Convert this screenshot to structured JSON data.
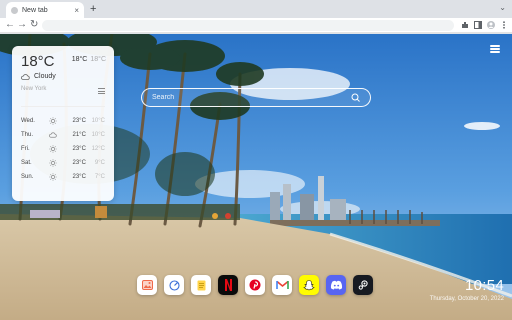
{
  "browser": {
    "tab_title": "New tab",
    "tab_close": "×",
    "new_tab": "+",
    "tab_menu": "⌄",
    "back": "←",
    "forward": "→",
    "reload": "↻"
  },
  "weather": {
    "temperature": "18°C",
    "high": "18°C",
    "low": "18°C",
    "condition": "Cloudy",
    "city": "New York",
    "forecast": [
      {
        "day": "Wed.",
        "icon": "sun-icon",
        "high": "23°C",
        "low": "10°C"
      },
      {
        "day": "Thu.",
        "icon": "cloud-icon",
        "high": "21°C",
        "low": "10°C"
      },
      {
        "day": "Fri.",
        "icon": "sun-icon",
        "high": "23°C",
        "low": "12°C"
      },
      {
        "day": "Sat.",
        "icon": "sun-icon",
        "high": "23°C",
        "low": "9°C"
      },
      {
        "day": "Sun.",
        "icon": "sun-icon",
        "high": "23°C",
        "low": "7°C"
      }
    ]
  },
  "search": {
    "placeholder": "Search"
  },
  "dock": {
    "apps": [
      {
        "name": "gallery-app-icon",
        "color": "#ffffff"
      },
      {
        "name": "compass-app-icon",
        "color": "#ffffff"
      },
      {
        "name": "notes-app-icon",
        "color": "#ffffff"
      },
      {
        "name": "netflix-app-icon",
        "color": "#0b0b0b"
      },
      {
        "name": "pinterest-app-icon",
        "color": "#ffffff"
      },
      {
        "name": "gmail-app-icon",
        "color": "#ffffff"
      },
      {
        "name": "snapchat-app-icon",
        "color": "#fffc00"
      },
      {
        "name": "discord-app-icon",
        "color": "#5865f2"
      },
      {
        "name": "steam-app-icon",
        "color": "#171a21"
      }
    ]
  },
  "clock": {
    "time": "10:54",
    "date": "Thursday, October 20, 2022"
  }
}
